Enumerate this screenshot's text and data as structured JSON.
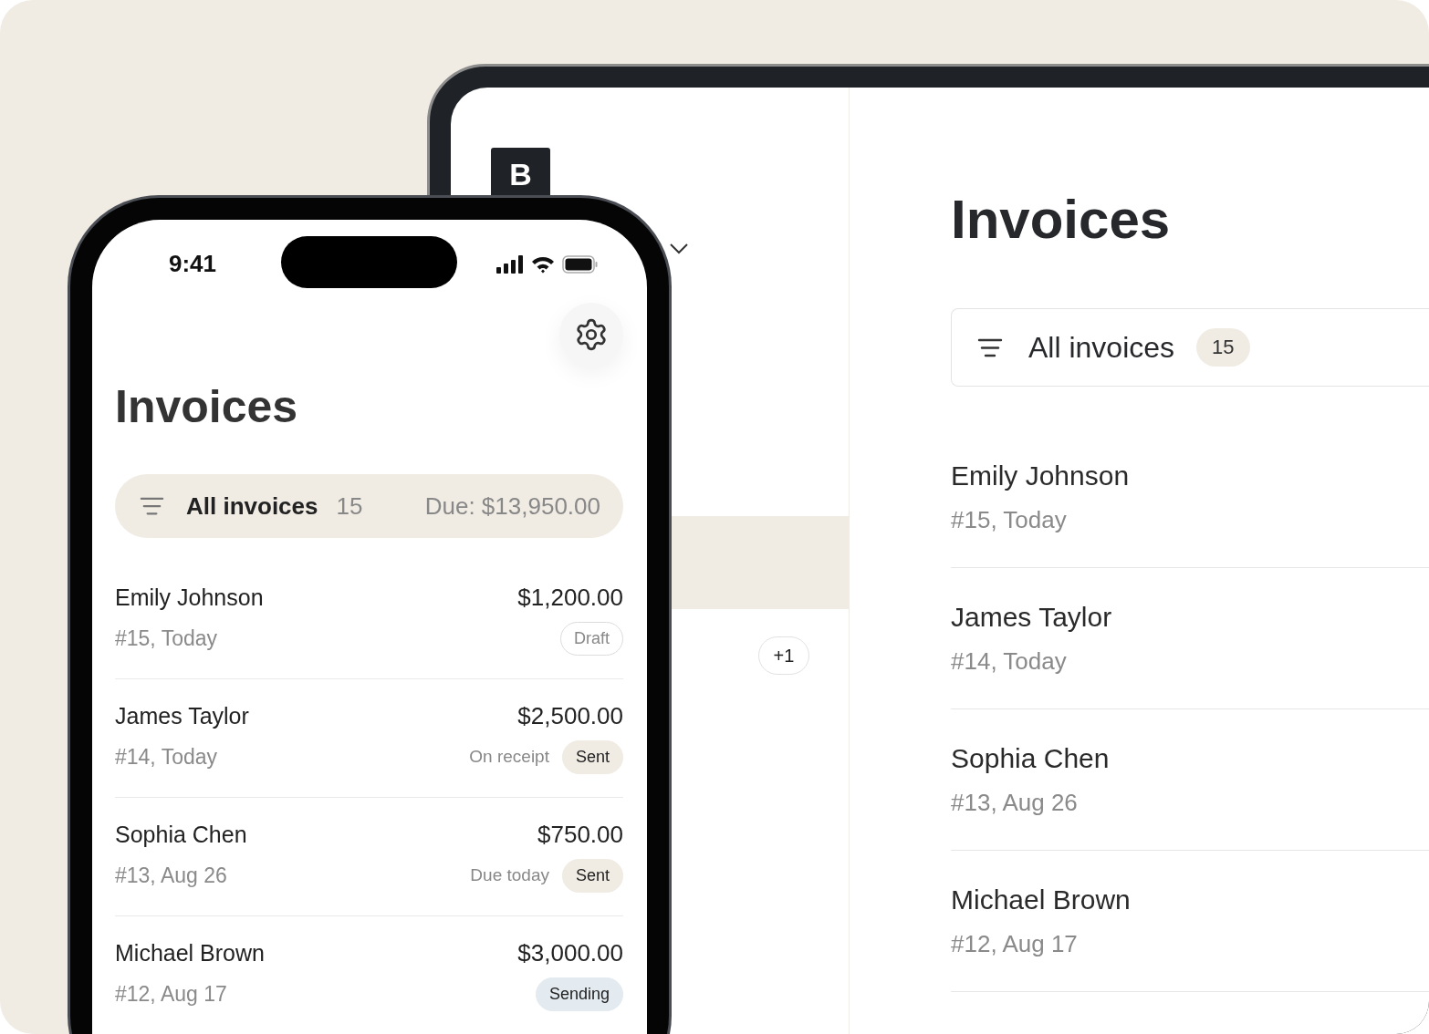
{
  "tablet": {
    "logo": "B",
    "extra_count": "+1",
    "title": "Invoices",
    "filter": {
      "label": "All invoices",
      "count": "15"
    },
    "invoices": [
      {
        "name": "Emily Johnson",
        "meta": "#15, Today"
      },
      {
        "name": "James Taylor",
        "meta": "#14, Today"
      },
      {
        "name": "Sophia Chen",
        "meta": "#13, Aug 26"
      },
      {
        "name": "Michael Brown",
        "meta": "#12, Aug 17"
      }
    ]
  },
  "phone": {
    "status_bar": {
      "time": "9:41"
    },
    "title": "Invoices",
    "filter": {
      "label": "All invoices",
      "count": "15",
      "due": "Due: $13,950.00"
    },
    "invoices": [
      {
        "name": "Emily Johnson",
        "meta": "#15, Today",
        "amount": "$1,200.00",
        "status": "Draft",
        "kind": "draft"
      },
      {
        "name": "James Taylor",
        "meta": "#14, Today",
        "amount": "$2,500.00",
        "note": "On receipt",
        "status": "Sent",
        "kind": "sent"
      },
      {
        "name": "Sophia Chen",
        "meta": "#13, Aug 26",
        "amount": "$750.00",
        "note": "Due today",
        "status": "Sent",
        "kind": "sent"
      },
      {
        "name": "Michael Brown",
        "meta": "#12, Aug 17",
        "amount": "$3,000.00",
        "status": "Sending",
        "kind": "sending"
      }
    ]
  }
}
